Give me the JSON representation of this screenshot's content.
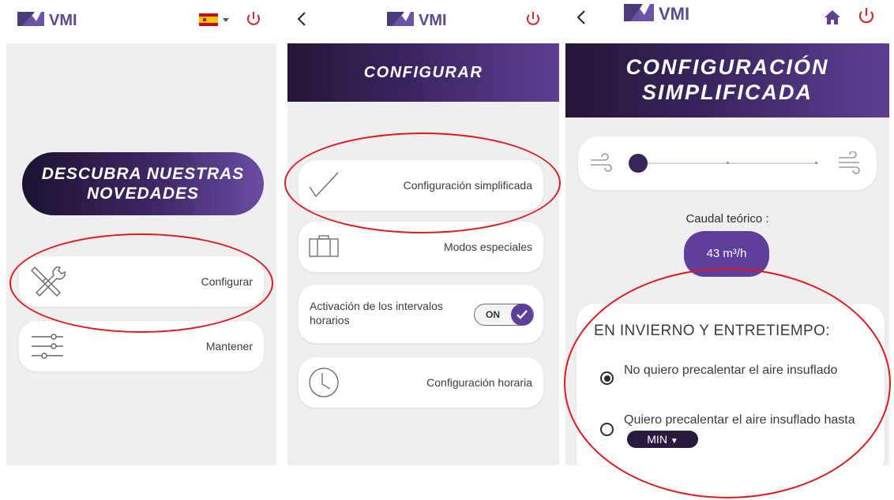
{
  "brand": {
    "logo_text": "VMI"
  },
  "screen1": {
    "language": {
      "flag": "spain-flag"
    },
    "promo_text": "DESCUBRA NUESTRAS NOVEDADES",
    "menu": [
      {
        "label": "Configurar",
        "icon": "tools-icon"
      },
      {
        "label": "Mantener",
        "icon": "sliders-icon"
      }
    ]
  },
  "screen2": {
    "title": "CONFIGURAR",
    "menu": [
      {
        "label": "Configuración simplificada",
        "icon": "checkmark-icon"
      },
      {
        "label": "Modos especiales",
        "icon": "suitcase-icon"
      },
      {
        "label": "Configuración horaria",
        "icon": "clock-icon"
      }
    ],
    "intervals": {
      "label": "Activación de los intervalos horarios",
      "toggle_label": "ON",
      "enabled": true
    }
  },
  "screen3": {
    "title_line1": "CONFIGURACIÓN",
    "title_line2": "SIMPLIFICADA",
    "slider": {
      "value_fraction": 0.0,
      "steps": 3
    },
    "flow_label": "Caudal teórico :",
    "flow_value": "43 m³/h",
    "season_title": "EN INVIERNO Y ENTRETIEMPO:",
    "options": [
      {
        "text": "No quiero precalentar el aire insuflado",
        "selected": true
      },
      {
        "text_before": "Quiero precalentar el aire insuflado hasta",
        "selected": false,
        "dropdown_value": "MIN"
      }
    ]
  },
  "colors": {
    "brand_purple": "#5e3f9c",
    "dark_purple": "#231636",
    "power_red": "#d9262c",
    "annotation_red": "#e0191d"
  }
}
